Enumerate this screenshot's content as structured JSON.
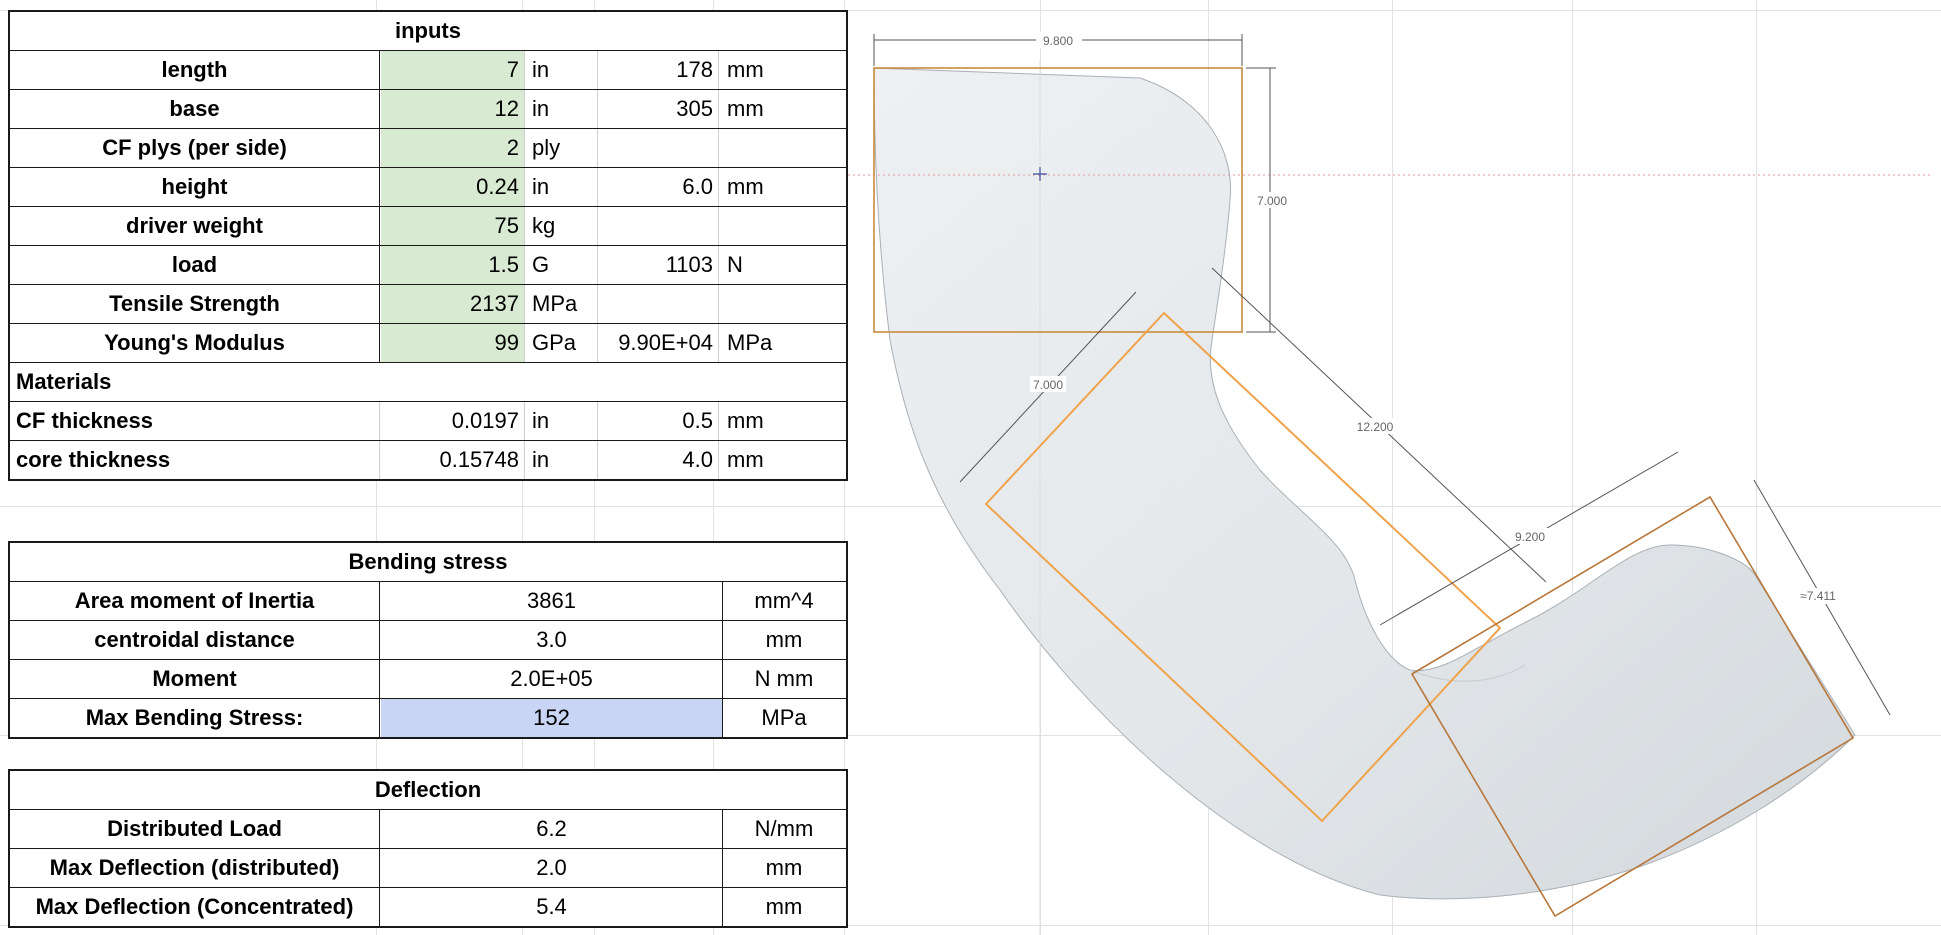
{
  "inputs": {
    "title": "inputs",
    "rows": [
      {
        "label": "length",
        "value": "7",
        "unit": "in",
        "value2": "178",
        "unit2": "mm"
      },
      {
        "label": "base",
        "value": "12",
        "unit": "in",
        "value2": "305",
        "unit2": "mm"
      },
      {
        "label": "CF plys (per side)",
        "value": "2",
        "unit": "ply",
        "value2": "",
        "unit2": ""
      },
      {
        "label": "height",
        "value": "0.24",
        "unit": "in",
        "value2": "6.0",
        "unit2": "mm"
      },
      {
        "label": "driver weight",
        "value": "75",
        "unit": "kg",
        "value2": "",
        "unit2": ""
      },
      {
        "label": "load",
        "value": "1.5",
        "unit": "G",
        "value2": "1103",
        "unit2": "N"
      },
      {
        "label": "Tensile Strength",
        "value": "2137",
        "unit": "MPa",
        "value2": "",
        "unit2": ""
      },
      {
        "label": "Young's Modulus",
        "value": "99",
        "unit": "GPa",
        "value2": "9.90E+04",
        "unit2": "MPa"
      }
    ],
    "materials_title": "Materials",
    "materials": [
      {
        "label": "CF thickness",
        "value": "0.0197",
        "unit": "in",
        "value2": "0.5",
        "unit2": "mm"
      },
      {
        "label": "core thickness",
        "value": "0.15748",
        "unit": "in",
        "value2": "4.0",
        "unit2": "mm"
      }
    ]
  },
  "bending": {
    "title": "Bending stress",
    "rows": [
      {
        "label": "Area moment of Inertia",
        "value": "3861",
        "unit": "mm^4"
      },
      {
        "label": "centroidal distance",
        "value": "3.0",
        "unit": "mm"
      },
      {
        "label": "Moment",
        "value": "2.0E+05",
        "unit": "N mm"
      },
      {
        "label": "Max Bending Stress:",
        "value": "152",
        "unit": "MPa"
      }
    ]
  },
  "deflection": {
    "title": "Deflection",
    "rows": [
      {
        "label": "Distributed Load",
        "value": "6.2",
        "unit": "N/mm"
      },
      {
        "label": "Max Deflection (distributed)",
        "value": "2.0",
        "unit": "mm"
      },
      {
        "label": "Max Deflection (Concentrated)",
        "value": "5.4",
        "unit": "mm"
      }
    ]
  },
  "drawing": {
    "dims": [
      "9.800",
      "7.000",
      "7.000",
      "12.200",
      "9.200",
      "≈7.411"
    ]
  },
  "colors": {
    "input_fill": "#d9ead3",
    "result_fill": "#c9d5f5",
    "rect_orange": "#f0a24a",
    "rect_brown": "#b7773a",
    "part_fill": "#e8ebee"
  }
}
